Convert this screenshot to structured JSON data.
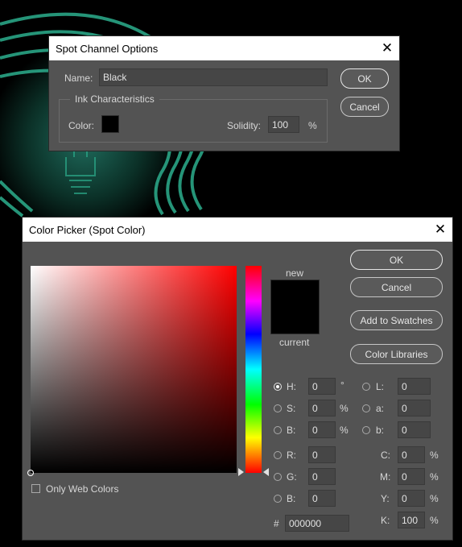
{
  "spot_dialog": {
    "title": "Spot Channel Options",
    "name_label": "Name:",
    "name_value": "Black",
    "ok_label": "OK",
    "cancel_label": "Cancel",
    "ink_group_label": "Ink Characteristics",
    "color_label": "Color:",
    "color_swatch": "#000000",
    "solidity_label": "Solidity:",
    "solidity_value": "100",
    "solidity_unit": "%"
  },
  "picker": {
    "title": "Color Picker (Spot Color)",
    "buttons": {
      "ok": "OK",
      "cancel": "Cancel",
      "add_swatches": "Add to Swatches",
      "color_libraries": "Color Libraries"
    },
    "new_label": "new",
    "current_label": "current",
    "only_web_colors": "Only Web Colors",
    "hue_color": "#ff0000",
    "hsb": {
      "h_label": "H:",
      "h_value": "0",
      "h_unit": "°",
      "s_label": "S:",
      "s_value": "0",
      "s_unit": "%",
      "b_label": "B:",
      "b_value": "0",
      "b_unit": "%"
    },
    "rgb": {
      "r_label": "R:",
      "r_value": "0",
      "g_label": "G:",
      "g_value": "0",
      "b_label": "B:",
      "b_value": "0"
    },
    "lab": {
      "l_label": "L:",
      "l_value": "0",
      "a_label": "a:",
      "a_value": "0",
      "b_label": "b:",
      "b_value": "0"
    },
    "cmyk": {
      "c_label": "C:",
      "c_value": "0",
      "c_unit": "%",
      "m_label": "M:",
      "m_value": "0",
      "m_unit": "%",
      "y_label": "Y:",
      "y_value": "0",
      "y_unit": "%",
      "k_label": "K:",
      "k_value": "100",
      "k_unit": "%"
    },
    "hex_label": "#",
    "hex_value": "000000"
  }
}
